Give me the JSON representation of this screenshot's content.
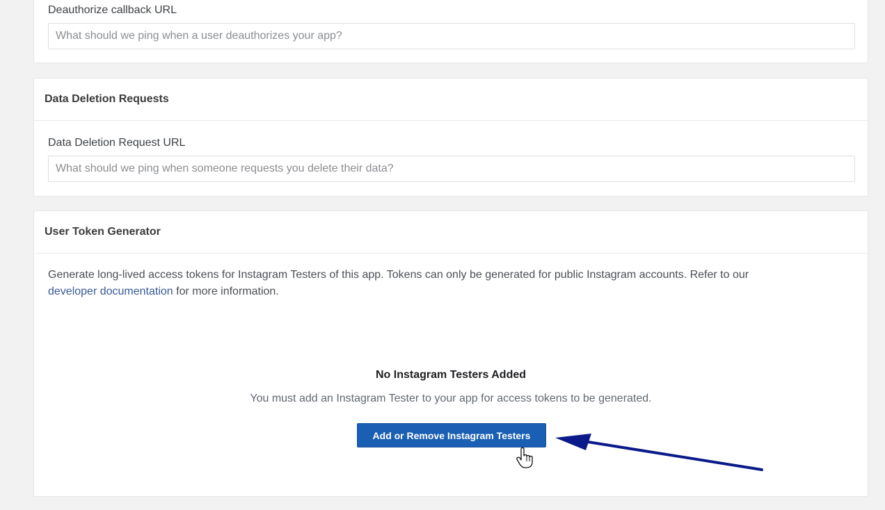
{
  "deauthorize": {
    "label": "Deauthorize callback URL",
    "placeholder": "What should we ping when a user deauthorizes your app?",
    "value": ""
  },
  "data_deletion": {
    "title": "Data Deletion Requests",
    "label": "Data Deletion Request URL",
    "placeholder": "What should we ping when someone requests you delete their data?",
    "value": ""
  },
  "token_generator": {
    "title": "User Token Generator",
    "description": "Generate long-lived access tokens for Instagram Testers of this app. Tokens can only be generated for public Instagram accounts. Refer to our",
    "link_text": "developer documentation",
    "description_end": "for more information.",
    "empty_title": "No Instagram Testers Added",
    "empty_text": "You must add an Instagram Tester to your app for access tokens to be generated.",
    "button_label": "Add or Remove Instagram Testers"
  },
  "colors": {
    "button": "#1a5fb4",
    "link": "#365899",
    "annotation_arrow": "#0a1a8a"
  },
  "icons": [
    "hand-pointer-cursor-icon",
    "annotation-arrow-icon"
  ]
}
